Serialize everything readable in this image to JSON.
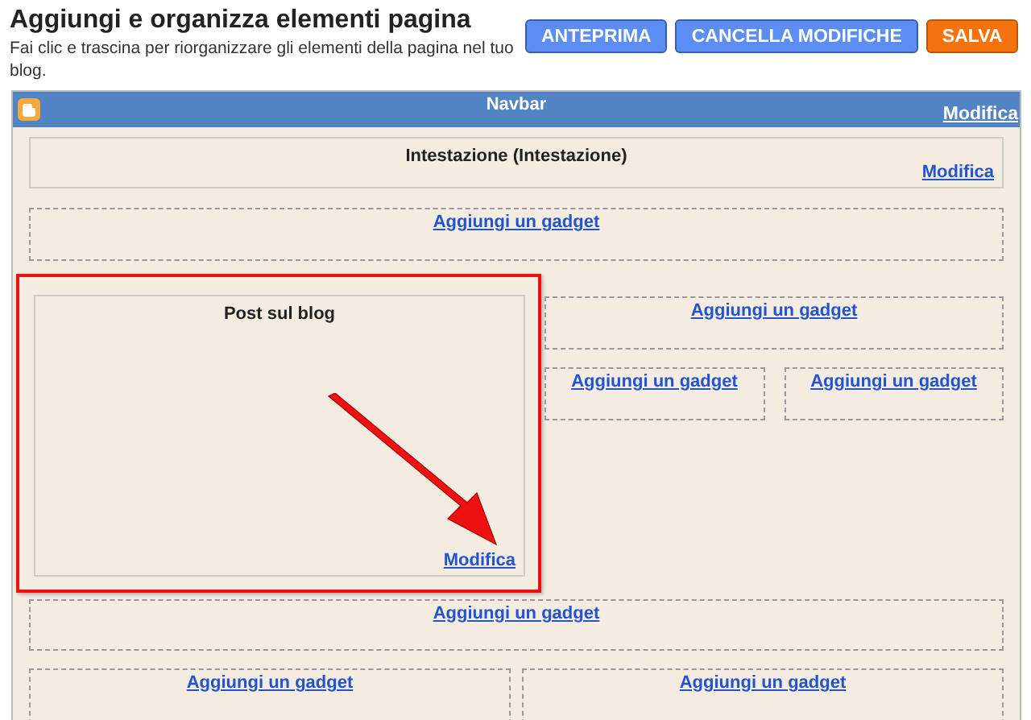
{
  "header": {
    "title": "Aggiungi e organizza elementi pagina",
    "description": "Fai clic e trascina per riorganizzare gli elementi della pagina nel tuo blog."
  },
  "buttons": [
    {
      "label": "ANTEPRIMA",
      "kind": "primary"
    },
    {
      "label": "CANCELLA MODIFICHE",
      "kind": "primary"
    },
    {
      "label": "SALVA",
      "kind": "save"
    }
  ],
  "navbar": {
    "title": "Navbar",
    "link": "Modifica"
  },
  "header_widget": {
    "title": "Intestazione (Intestazione)",
    "link": "Modifica"
  },
  "top_slot": {
    "link": "Aggiungi un gadget"
  },
  "post_widget": {
    "title": "Post sul blog",
    "link": "Modifica",
    "highlighted": true
  },
  "sidebar_slot": {
    "link": "Aggiungi un gadget"
  },
  "sidebar_pair": [
    {
      "link": "Aggiungi un gadget"
    },
    {
      "link": "Aggiungi un gadget"
    }
  ],
  "bottom_slot": {
    "link": "Aggiungi un gadget"
  },
  "footer_pair": [
    {
      "link": "Aggiungi un gadget"
    },
    {
      "link": "Aggiungi un gadget"
    }
  ]
}
